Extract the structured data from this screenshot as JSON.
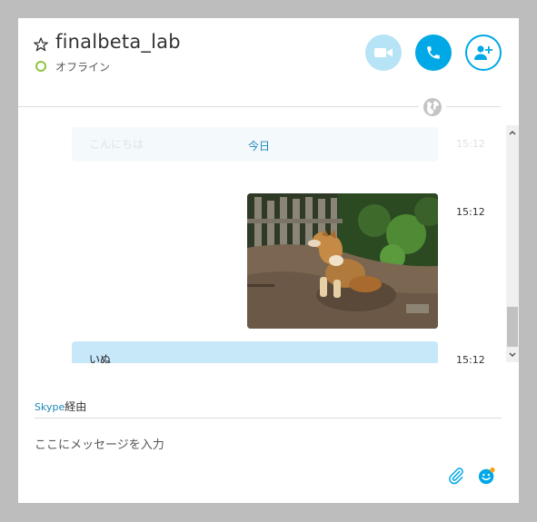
{
  "header": {
    "contact_name": "finalbeta_lab",
    "status": "オフライン",
    "icons": [
      "star-icon",
      "video-call-icon",
      "audio-call-icon",
      "add-contact-icon",
      "globe-icon"
    ]
  },
  "chat": {
    "ghost_message": "こんにちは",
    "date_separator": "今日",
    "ghost_time": "15:12",
    "messages": [
      {
        "type": "image",
        "alt": "photo of a dog sitting on dirt",
        "time": "15:12"
      },
      {
        "type": "text",
        "text": "いぬ",
        "time": "15:12"
      }
    ]
  },
  "footer": {
    "via_prefix": "Skype",
    "via_suffix": "経由",
    "input_placeholder": "ここにメッセージを入力",
    "input_value": ""
  },
  "colors": {
    "accent": "#00a8e6",
    "video_button": "#b7e3f6",
    "bubble": "#c7e8f9",
    "offline_presence": "#8cc63f",
    "link_text": "#1d86b6"
  }
}
